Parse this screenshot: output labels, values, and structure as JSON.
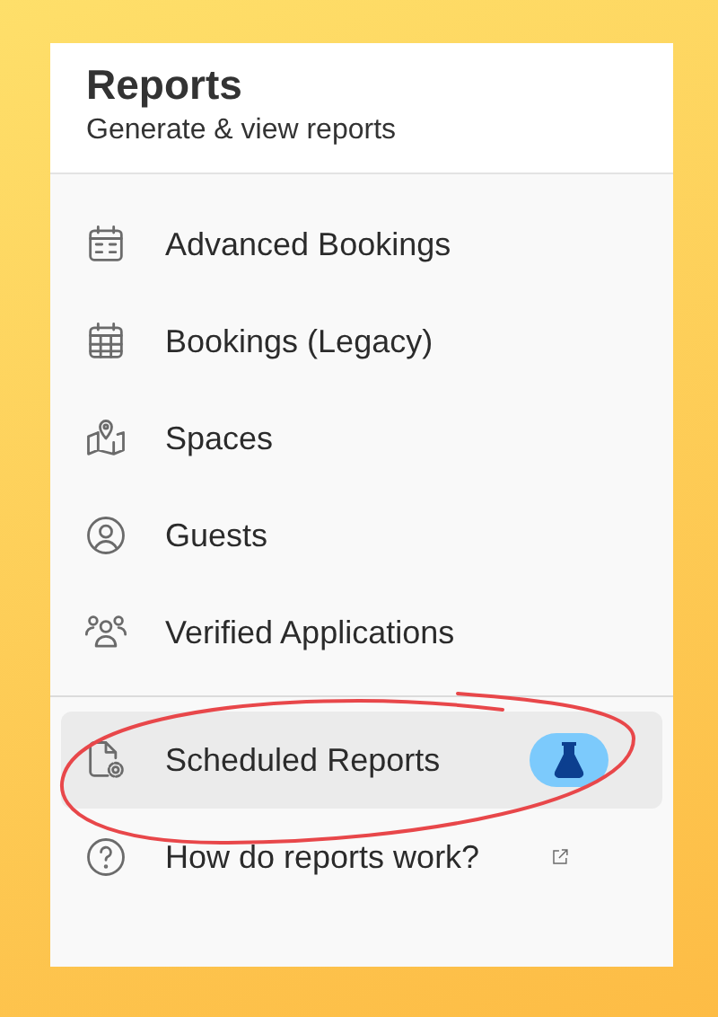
{
  "header": {
    "title": "Reports",
    "subtitle": "Generate & view reports"
  },
  "menu": [
    {
      "label": "Advanced Bookings",
      "selected": false
    },
    {
      "label": "Bookings (Legacy)",
      "selected": false
    },
    {
      "label": "Spaces",
      "selected": false
    },
    {
      "label": "Guests",
      "selected": false
    },
    {
      "label": "Verified Applications",
      "selected": false
    }
  ],
  "secondary": [
    {
      "label": "Scheduled Reports",
      "selected": true,
      "kind": "beta"
    },
    {
      "label": "How do reports work?",
      "selected": false,
      "kind": "external"
    }
  ]
}
